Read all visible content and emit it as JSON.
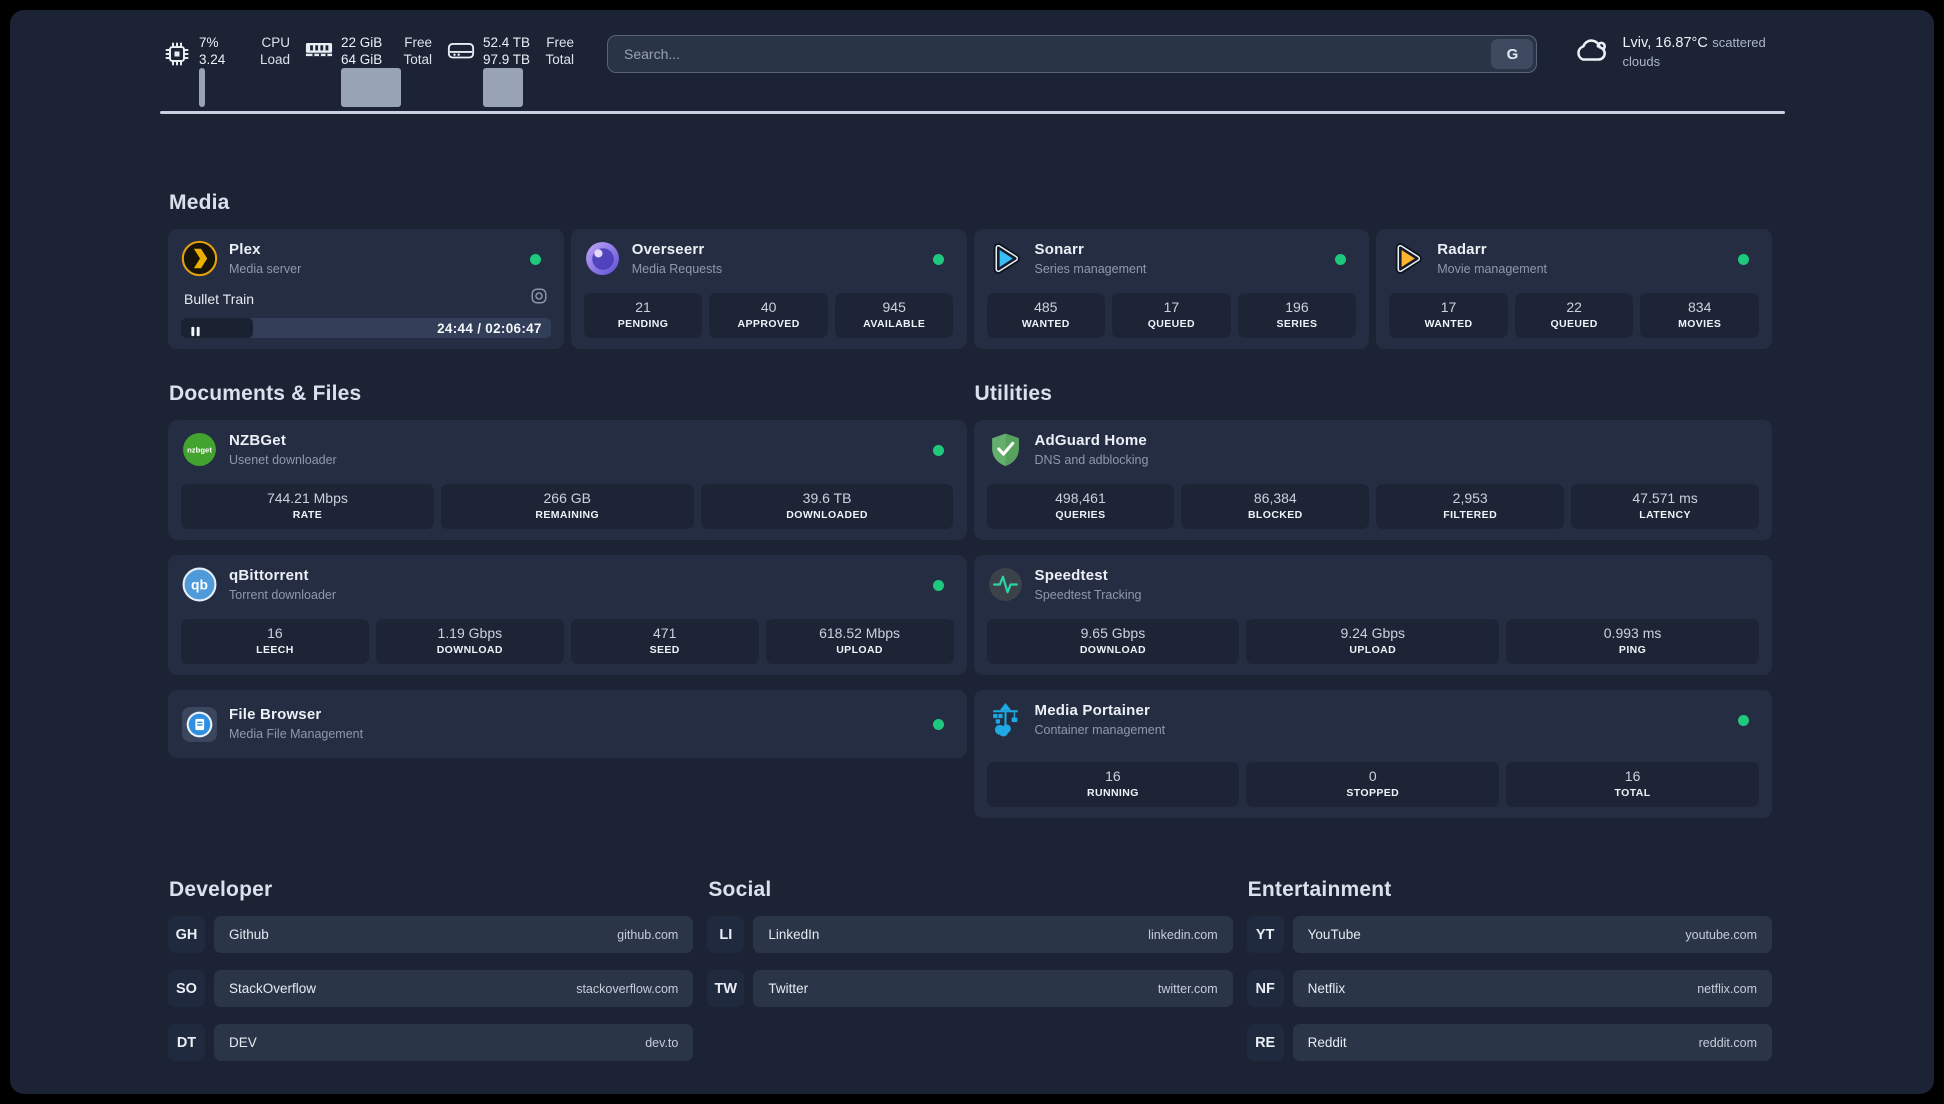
{
  "header": {
    "cpu": {
      "line1": "7%",
      "line2": "3.24",
      "label1": "CPU",
      "label2": "Load",
      "percent": 7
    },
    "memory": {
      "line1": "22 GiB",
      "line2": "64 GiB",
      "label1": "Free",
      "label2": "Total",
      "percent": 66
    },
    "disk": {
      "line1": "52.4 TB",
      "line2": "97.9 TB",
      "label1": "Free",
      "label2": "Total",
      "percent": 44
    },
    "search": {
      "placeholder": "Search...",
      "button_label": "G"
    },
    "weather": {
      "location": "Lviv, 16.87°C",
      "condition": "scattered clouds"
    }
  },
  "colors": {
    "status_online": "#1EC97E",
    "plex_yellow": "#E5A00D",
    "sonarr_blue": "#38BDF8",
    "radarr_yellow": "#FDB52F",
    "nzbget_green": "#43A32F",
    "qbittorrent_blue": "#4F9BD9",
    "adguard_green": "#63B06E",
    "speedtest_green": "#2DD4A0",
    "portainer_blue": "#1FA9E4"
  },
  "sections": {
    "media": {
      "title": "Media",
      "plex": {
        "title": "Plex",
        "subtitle": "Media server",
        "now_playing": "Bullet Train",
        "time": "24:44 / 02:06:47",
        "progress_percent": 19.5
      },
      "overseerr": {
        "title": "Overseerr",
        "subtitle": "Media Requests",
        "stats": [
          {
            "value": "21",
            "label": "PENDING"
          },
          {
            "value": "40",
            "label": "APPROVED"
          },
          {
            "value": "945",
            "label": "AVAILABLE"
          }
        ]
      },
      "sonarr": {
        "title": "Sonarr",
        "subtitle": "Series management",
        "stats": [
          {
            "value": "485",
            "label": "WANTED"
          },
          {
            "value": "17",
            "label": "QUEUED"
          },
          {
            "value": "196",
            "label": "SERIES"
          }
        ]
      },
      "radarr": {
        "title": "Radarr",
        "subtitle": "Movie management",
        "stats": [
          {
            "value": "17",
            "label": "WANTED"
          },
          {
            "value": "22",
            "label": "QUEUED"
          },
          {
            "value": "834",
            "label": "MOVIES"
          }
        ]
      }
    },
    "documents": {
      "title": "Documents & Files",
      "nzbget": {
        "title": "NZBGet",
        "subtitle": "Usenet downloader",
        "stats": [
          {
            "value": "744.21 Mbps",
            "label": "RATE"
          },
          {
            "value": "266 GB",
            "label": "REMAINING"
          },
          {
            "value": "39.6 TB",
            "label": "DOWNLOADED"
          }
        ]
      },
      "qbittorrent": {
        "title": "qBittorrent",
        "subtitle": "Torrent downloader",
        "stats": [
          {
            "value": "16",
            "label": "LEECH"
          },
          {
            "value": "1.19 Gbps",
            "label": "DOWNLOAD"
          },
          {
            "value": "471",
            "label": "SEED"
          },
          {
            "value": "618.52 Mbps",
            "label": "UPLOAD"
          }
        ]
      },
      "filebrowser": {
        "title": "File Browser",
        "subtitle": "Media File Management"
      }
    },
    "utilities": {
      "title": "Utilities",
      "adguard": {
        "title": "AdGuard Home",
        "subtitle": "DNS and adblocking",
        "stats": [
          {
            "value": "498,461",
            "label": "QUERIES"
          },
          {
            "value": "86,384",
            "label": "BLOCKED"
          },
          {
            "value": "2,953",
            "label": "FILTERED"
          },
          {
            "value": "47.571 ms",
            "label": "LATENCY"
          }
        ]
      },
      "speedtest": {
        "title": "Speedtest",
        "subtitle": "Speedtest Tracking",
        "stats": [
          {
            "value": "9.65 Gbps",
            "label": "DOWNLOAD"
          },
          {
            "value": "9.24 Gbps",
            "label": "UPLOAD"
          },
          {
            "value": "0.993 ms",
            "label": "PING"
          }
        ]
      },
      "portainer": {
        "title": "Media Portainer",
        "subtitle": "Container management",
        "stats": [
          {
            "value": "16",
            "label": "RUNNING"
          },
          {
            "value": "0",
            "label": "STOPPED"
          },
          {
            "value": "16",
            "label": "TOTAL"
          }
        ]
      }
    },
    "bookmarks": {
      "developer": {
        "title": "Developer",
        "items": [
          {
            "abbr": "GH",
            "name": "Github",
            "domain": "github.com"
          },
          {
            "abbr": "SO",
            "name": "StackOverflow",
            "domain": "stackoverflow.com"
          },
          {
            "abbr": "DT",
            "name": "DEV",
            "domain": "dev.to"
          }
        ]
      },
      "social": {
        "title": "Social",
        "items": [
          {
            "abbr": "LI",
            "name": "LinkedIn",
            "domain": "linkedin.com"
          },
          {
            "abbr": "TW",
            "name": "Twitter",
            "domain": "twitter.com"
          }
        ]
      },
      "entertainment": {
        "title": "Entertainment",
        "items": [
          {
            "abbr": "YT",
            "name": "YouTube",
            "domain": "youtube.com"
          },
          {
            "abbr": "NF",
            "name": "Netflix",
            "domain": "netflix.com"
          },
          {
            "abbr": "RE",
            "name": "Reddit",
            "domain": "reddit.com"
          }
        ]
      }
    }
  }
}
